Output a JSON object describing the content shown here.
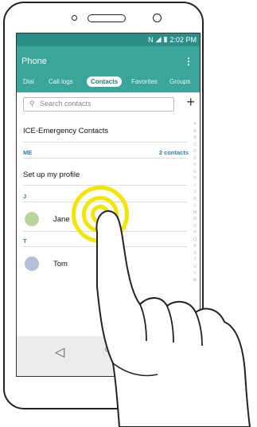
{
  "status_bar": {
    "time": "2:02 PM"
  },
  "app_bar": {
    "title": "Phone",
    "menu_icon": "more-vert-icon"
  },
  "tabs": [
    {
      "label": "Dial",
      "active": false
    },
    {
      "label": "Call logs",
      "active": false
    },
    {
      "label": "Contacts",
      "active": true
    },
    {
      "label": "Favorites",
      "active": false
    },
    {
      "label": "Groups",
      "active": false
    }
  ],
  "search": {
    "placeholder": "Search contacts",
    "icon": "search-icon",
    "add_icon": "plus-icon"
  },
  "ice": {
    "label": "ICE-Emergency Contacts"
  },
  "me_section": {
    "header": "ME",
    "count": "2 contacts"
  },
  "profile": {
    "label": "Set up my profile"
  },
  "contacts": [
    {
      "section": "J",
      "name": "Jane"
    },
    {
      "section": "T",
      "name": "Tom"
    }
  ],
  "index_letters": [
    "#",
    "A",
    "B",
    "C",
    "D",
    "E",
    "F",
    "G",
    "H",
    "I",
    "J",
    "K",
    "L",
    "M",
    "N",
    "O",
    "P",
    "Q",
    "R",
    "S",
    "T",
    "U",
    "V",
    "W"
  ],
  "colors": {
    "accent": "#3aa69b",
    "status": "#2b8f88",
    "tap_ring": "#f2e600"
  }
}
